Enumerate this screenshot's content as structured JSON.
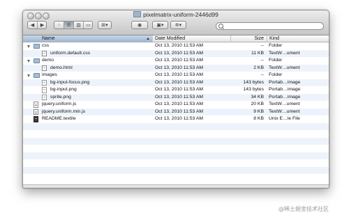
{
  "window": {
    "title": "pixelmatrix-uniform-2446d99"
  },
  "toolbar": {
    "back_icon": "chevron-left-icon",
    "forward_icon": "chevron-right-icon",
    "view_icons": [
      "grid-view-icon",
      "list-view-icon",
      "columns-view-icon",
      "coverflow-view-icon"
    ],
    "arrange_icon": "arrange-icon",
    "quicklook_icon": "eye-icon",
    "share_icon": "share-icon",
    "action_icon": "gear-icon",
    "search_placeholder": ""
  },
  "columns": {
    "name": "Name",
    "date": "Date Modified",
    "size": "Size",
    "kind": "Kind"
  },
  "rows": [
    {
      "name": "css",
      "date": "Oct 13, 2010 11:53 AM",
      "size": "--",
      "kind": "Folder",
      "type": "folder",
      "level": 0
    },
    {
      "name": "uniform.default.css",
      "date": "Oct 13, 2010 11:53 AM",
      "size": "11 KB",
      "kind": "TextW…ument",
      "type": "doc",
      "level": 1
    },
    {
      "name": "demo",
      "date": "Oct 13, 2010 11:53 AM",
      "size": "--",
      "kind": "Folder",
      "type": "folder",
      "level": 0
    },
    {
      "name": "demo.html",
      "date": "Oct 13, 2010 11:53 AM",
      "size": "2 KB",
      "kind": "TextW…ument",
      "type": "doc",
      "level": 1
    },
    {
      "name": "images",
      "date": "Oct 13, 2010 11:53 AM",
      "size": "--",
      "kind": "Folder",
      "type": "folder",
      "level": 0
    },
    {
      "name": "bg-input-focus.png",
      "date": "Oct 13, 2010 11:53 AM",
      "size": "143 bytes",
      "kind": "Portab…image",
      "type": "img",
      "level": 1
    },
    {
      "name": "bg-input.png",
      "date": "Oct 13, 2010 11:53 AM",
      "size": "143 bytes",
      "kind": "Portab…image",
      "type": "img",
      "level": 1
    },
    {
      "name": "sprite.png",
      "date": "Oct 13, 2010 11:53 AM",
      "size": "34 KB",
      "kind": "Portab…image",
      "type": "img",
      "level": 1
    },
    {
      "name": "jquery.uniform.js",
      "date": "Oct 13, 2010 11:53 AM",
      "size": "20 KB",
      "kind": "TextW…ument",
      "type": "script",
      "level": 0
    },
    {
      "name": "jquery.uniform.min.js",
      "date": "Oct 13, 2010 11:53 AM",
      "size": "9 KB",
      "kind": "TextW…ument",
      "type": "script",
      "level": 0
    },
    {
      "name": "README.textile",
      "date": "Oct 13, 2010 11:53 AM",
      "size": "8 KB",
      "kind": "Unix E…le File",
      "type": "text",
      "level": 0
    }
  ],
  "watermark": "@稀土掘金技术社区",
  "colors": {
    "header_selected": "#9fb7d4",
    "row_alt": "#eef3fb"
  }
}
